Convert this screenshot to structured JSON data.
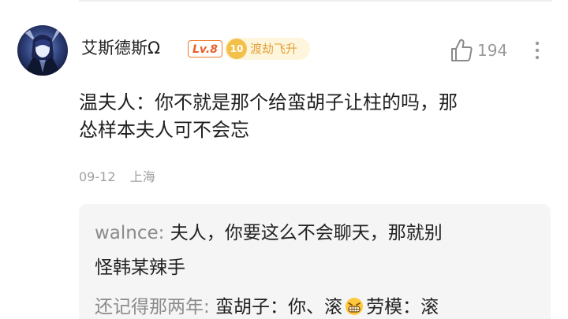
{
  "comment": {
    "username": "艾斯德斯Ω",
    "level": "Lv.8",
    "rank_number": "10",
    "rank_title": "渡劫飞升",
    "like_count": "194",
    "text_line1": "温夫人：你不就是那个给蛮胡子让柱的吗，那",
    "text_line2": "怂样本夫人可不会忘",
    "date": "09-12",
    "location": "上海"
  },
  "replies": [
    {
      "author": "walnce",
      "separator": ":",
      "text_line1": " 夫人，你要这么不会聊天，那就别",
      "text_line2": "怪韩某辣手"
    },
    {
      "author": "还记得那两年",
      "separator": ":",
      "text_before_emoji": " 蛮胡子：你、滚",
      "emoji": "grinning-face-emoji",
      "text_after_emoji": "劳模：滚"
    }
  ],
  "colors": {
    "level_badge": "#ee7a2a",
    "rank_badge_bg": "#fdf5dc",
    "rank_badge_text": "#e3a23b",
    "reply_author": "#8b8b8b",
    "meta": "#a0a0a0"
  }
}
